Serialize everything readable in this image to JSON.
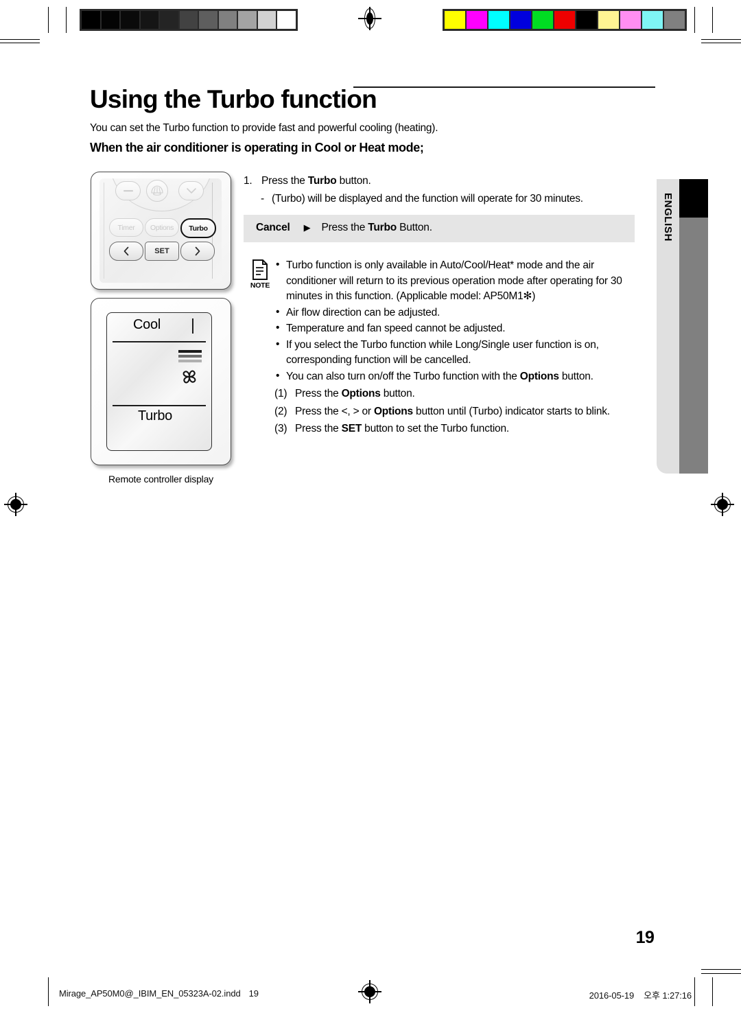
{
  "calibration": {
    "gray_patches": [
      "#000000",
      "#040404",
      "#0a0a0a",
      "#151515",
      "#242424",
      "#424242",
      "#5e5e5e",
      "#808080",
      "#a3a3a3",
      "#d2d2d2",
      "#ffffff"
    ],
    "color_patches": [
      "#ffff00",
      "#ff00ff",
      "#00ffff",
      "#0000dd",
      "#00dd22",
      "#ee0000",
      "#000000",
      "#fff493",
      "#ff8ef2",
      "#7ff5f5",
      "#808080"
    ],
    "registration_mark": "registration-target-icon"
  },
  "page": {
    "title": "Using the Turbo function",
    "intro": "You can set the Turbo function to provide fast and powerful cooling (heating).",
    "subheading": "When the air conditioner is operating in Cool or Heat mode;",
    "page_number": "19",
    "language_tab": "ENGLISH"
  },
  "steps": {
    "step1_number": "1.",
    "step1_pre": "Press the ",
    "step1_bold": "Turbo",
    "step1_post": " button.",
    "step1_dash": "-",
    "step1_sub": "(Turbo) will be displayed and the function will operate for 30 minutes."
  },
  "cancel_bar": {
    "label": "Cancel",
    "arrow": "▶",
    "pre": "Press the ",
    "bold": "Turbo",
    "post": " Button."
  },
  "note": {
    "icon_label": "NOTE",
    "bullet": "•",
    "items": [
      "Turbo function is only available in Auto/Cool/Heat* mode and the air conditioner will return to its previous operation mode after operating for 30 minutes in this function. (Applicable model: AP50M1✻)",
      "Air flow direction can be adjusted.",
      "Temperature and fan speed cannot be adjusted.",
      "If you select the Turbo function while Long/Single user function is on, corresponding function will be cancelled."
    ],
    "last_bullet_pre": "You can also turn on/off the Turbo function with the ",
    "last_bullet_bold": "Options",
    "last_bullet_post": " button.",
    "sub_steps": [
      {
        "n": "(1)",
        "pre": "Press the ",
        "bold": "Options",
        "post": " button."
      },
      {
        "n": "(2)",
        "pre": "Press the <, > or ",
        "bold": "Options",
        "post": " button until (Turbo) indicator starts to blink."
      },
      {
        "n": "(3)",
        "pre": "Press the ",
        "bold": "SET",
        "post": " button to set the Turbo function."
      }
    ]
  },
  "remote": {
    "top_buttons": [
      "minus-button-icon",
      "fan-swing-button-icon",
      "chevron-down-button-icon"
    ],
    "option_buttons": [
      "Timer",
      "Options",
      "Turbo"
    ],
    "nav_buttons": [
      "‹",
      "SET",
      "›"
    ],
    "highlighted_button": "Turbo"
  },
  "display": {
    "mode_label": "Cool",
    "function_label": "Turbo",
    "fan_icon": "fan-blade-icon",
    "fan_bars": "fan-speed-bars-icon",
    "caption": "Remote controller display"
  },
  "footer": {
    "file_name": "Mirage_AP50M0@_IBIM_EN_05323A-02.indd",
    "page": "19",
    "date": "2016-05-19",
    "time": "오후 1:27:16"
  }
}
